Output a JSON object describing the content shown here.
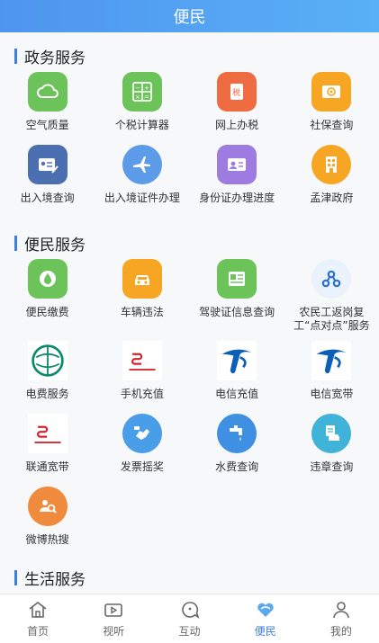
{
  "header": {
    "title": "便民"
  },
  "sections": [
    {
      "title": "政务服务",
      "items": [
        {
          "label": "空气质量",
          "icon": "cloud-icon",
          "color": "#6cc35a"
        },
        {
          "label": "个税计算器",
          "icon": "calculator-icon",
          "color": "#6cc35a"
        },
        {
          "label": "网上办税",
          "icon": "tax-icon",
          "color": "#ef6b42"
        },
        {
          "label": "社保查询",
          "icon": "social-security-card-icon",
          "color": "#f6a623"
        },
        {
          "label": "出入境查询",
          "icon": "id-card-pen-icon",
          "color": "#4b6fb0"
        },
        {
          "label": "出入境证件办理",
          "icon": "airplane-icon",
          "color": "#5b9be8"
        },
        {
          "label": "身份证办理进度",
          "icon": "id-card-icon",
          "color": "#9d7be0"
        },
        {
          "label": "孟津政府",
          "icon": "building-icon",
          "color": "#f6a623"
        }
      ]
    },
    {
      "title": "便民服务",
      "items": [
        {
          "label": "便民缴费",
          "icon": "water-drop-icon",
          "color": "#6cc35a"
        },
        {
          "label": "车辆违法",
          "icon": "car-icon",
          "color": "#f6a623"
        },
        {
          "label": "驾驶证信息查询",
          "icon": "driver-license-icon",
          "color": "#6cc35a"
        },
        {
          "label": "农民工返岗复工“点对点”服务",
          "icon": "connection-nodes-icon",
          "color": "#2a6fd6"
        },
        {
          "label": "电费服务",
          "icon": "state-grid-logo-icon",
          "color": "#0d8a6c"
        },
        {
          "label": "手机充值",
          "icon": "china-unicom-logo-icon",
          "color": "#d8202a"
        },
        {
          "label": "电信充值",
          "icon": "china-telecom-logo-icon",
          "color": "#0a5fb8"
        },
        {
          "label": "电信宽带",
          "icon": "china-telecom-logo-icon",
          "color": "#0a5fb8"
        },
        {
          "label": "联通宽带",
          "icon": "china-unicom-logo-icon",
          "color": "#d8202a"
        },
        {
          "label": "发票摇奖",
          "icon": "hand-shake-icon",
          "color": "#4a9de8"
        },
        {
          "label": "水费查询",
          "icon": "faucet-icon",
          "color": "#3f8fe3"
        },
        {
          "label": "违章查询",
          "icon": "car-violation-icon",
          "color": "#3fb3d8"
        },
        {
          "label": "微博热搜",
          "icon": "weibo-search-icon",
          "color": "#f08a3c"
        }
      ]
    },
    {
      "title": "生活服务",
      "items": []
    }
  ],
  "tabbar": [
    {
      "label": "首页",
      "icon": "home-icon",
      "active": false
    },
    {
      "label": "视听",
      "icon": "video-icon",
      "active": false
    },
    {
      "label": "互动",
      "icon": "chat-bubble-icon",
      "active": false
    },
    {
      "label": "便民",
      "icon": "heart-icon",
      "active": true
    },
    {
      "label": "我的",
      "icon": "user-icon",
      "active": false
    }
  ],
  "colors": {
    "accent": "#3b7fe0",
    "header_start": "#4e95f0",
    "header_end": "#59b0f5"
  }
}
